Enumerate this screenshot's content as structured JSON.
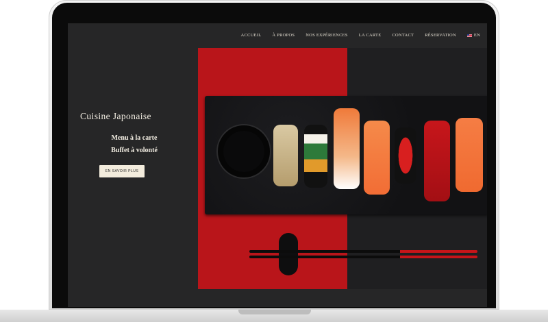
{
  "nav": {
    "items": [
      "ACCUEIL",
      "À PROPOS",
      "NOS EXPÉRIENCES",
      "LA CARTE",
      "CONTACT",
      "RÉSERVATION"
    ],
    "lang": "EN"
  },
  "hero": {
    "title": "Cuisine Japonaise",
    "line1": "Menu à la carte",
    "line2": "Buffet à volonté",
    "cta": "EN SAVOIR PLUS"
  },
  "icons": {
    "flag": "uk-flag-icon"
  },
  "colors": {
    "background": "#262627",
    "accent_red": "#b9151a",
    "text_cream": "#f2ede2",
    "button_bg": "#f3ecdd"
  }
}
